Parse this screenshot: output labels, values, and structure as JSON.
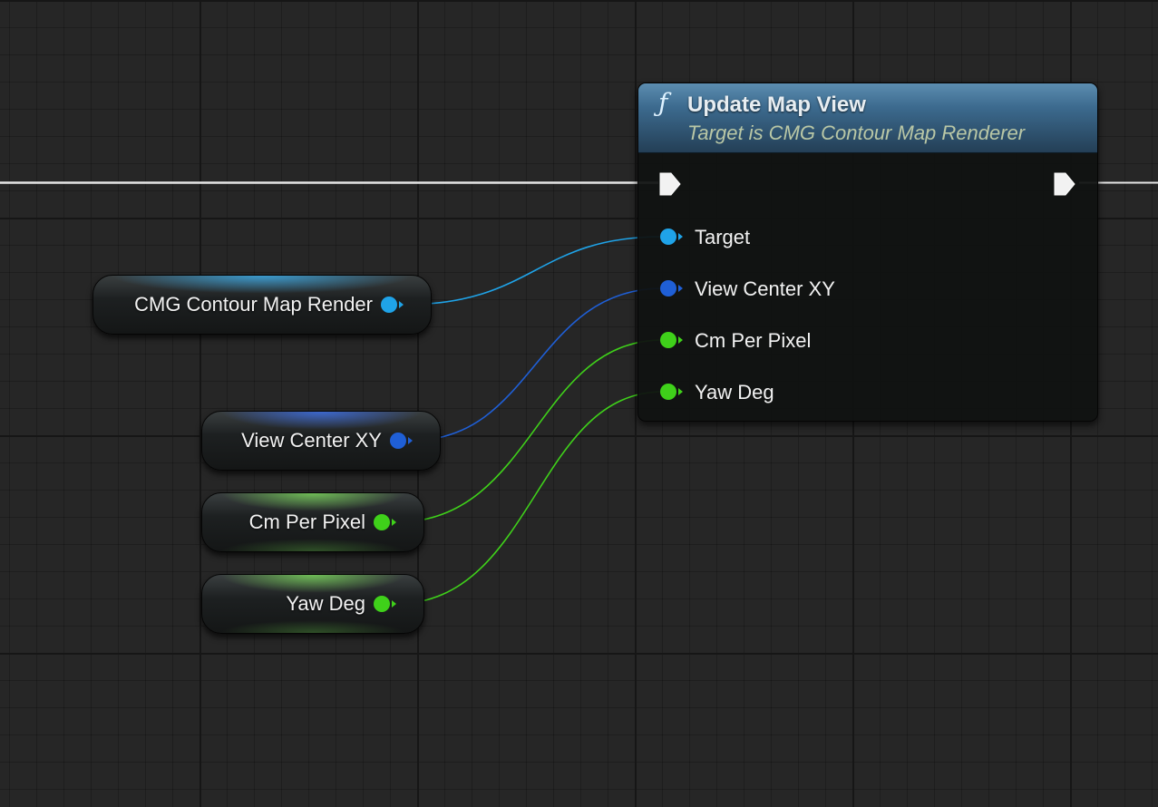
{
  "function_node": {
    "icon": "function-icon",
    "title": "Update Map View",
    "subtitle": "Target is CMG Contour Map Renderer",
    "header_color": "#3c6a8e",
    "inputs": [
      {
        "label": "Target",
        "pin_type": "object",
        "color": "#1fa3e8"
      },
      {
        "label": "View Center XY",
        "pin_type": "vector",
        "color": "#1f5fd6"
      },
      {
        "label": "Cm Per Pixel",
        "pin_type": "float",
        "color": "#3fd11a"
      },
      {
        "label": "Yaw Deg",
        "pin_type": "float",
        "color": "#3fd11a"
      }
    ]
  },
  "variables": [
    {
      "label": "CMG Contour Map Render",
      "pin_type": "object",
      "color": "#1fa3e8"
    },
    {
      "label": "View Center XY",
      "pin_type": "vector",
      "color": "#1f5fd6"
    },
    {
      "label": "Cm Per Pixel",
      "pin_type": "float",
      "color": "#3fd11a"
    },
    {
      "label": "Yaw Deg",
      "pin_type": "float",
      "color": "#3fd11a"
    }
  ],
  "colors": {
    "exec_wire": "#e6e6e6",
    "object_pin": "#1fa3e8",
    "vector_pin": "#1f5fd6",
    "float_pin": "#3fd11a",
    "graph_background": "#262626"
  }
}
